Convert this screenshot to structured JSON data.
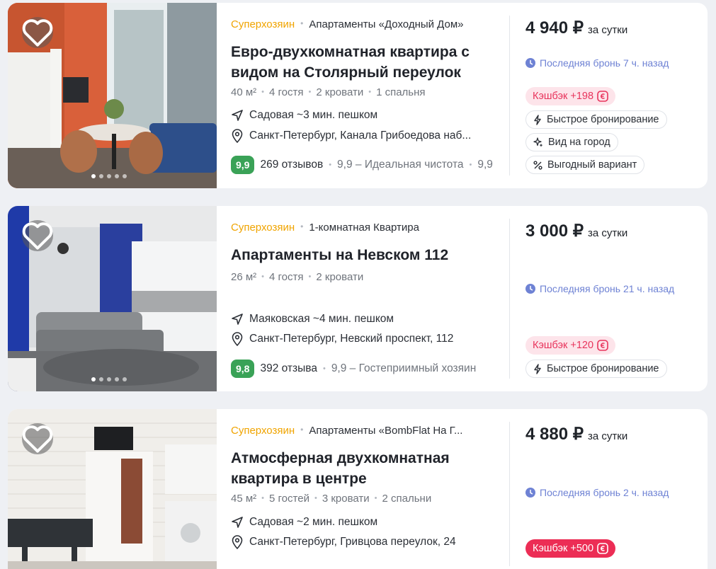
{
  "listings": [
    {
      "superhost": "Суперхозяин",
      "property_type": "Апартаменты «Доходный Дом»",
      "title": "Евро-двухкомнатная квартира с видом на Столярный переулок",
      "specs": [
        "40 м²",
        "4 гостя",
        "2 кровати",
        "1 спальня"
      ],
      "metro": "Садовая ~3 мин. пешком",
      "address": "Санкт-Петербург, Канала Грибоедова наб...",
      "score": "9,9",
      "reviews": "269 отзывов",
      "feature": "9,9 – Идеальная чистота",
      "feature_cut": "9,9",
      "price": "4 940 ₽",
      "per": "за сутки",
      "last_booking": "Последняя бронь 7 ч. назад",
      "cashback": "Кэшбэк +198",
      "tags": [
        "Быстрое бронирование",
        "Вид на город",
        "Выгодный вариант"
      ],
      "tag_icons": [
        "lightning-icon",
        "sparkle-icon",
        "percent-icon"
      ]
    },
    {
      "superhost": "Суперхозяин",
      "property_type": "1-комнатная Квартира",
      "title": "Апартаменты на Невском 112",
      "specs": [
        "26 м²",
        "4 гостя",
        "2 кровати"
      ],
      "metro": "Маяковская ~4 мин. пешком",
      "address": "Санкт-Петербург, Невский проспект, 112",
      "score": "9,8",
      "reviews": "392 отзыва",
      "feature": "9,9 – Гостеприимный хозяин",
      "price": "3 000 ₽",
      "per": "за сутки",
      "last_booking": "Последняя бронь 21 ч. назад",
      "cashback": "Кэшбэк +120",
      "tags": [
        "Быстрое бронирование"
      ],
      "tag_icons": [
        "lightning-icon"
      ]
    },
    {
      "superhost": "Суперхозяин",
      "property_type": "Апартаменты «BombFlat На Г...",
      "title": "Атмосферная двухкомнатная квартира в центре",
      "specs": [
        "45 м²",
        "5 гостей",
        "3 кровати",
        "2 спальни"
      ],
      "metro": "Садовая ~2 мин. пешком",
      "address": "Санкт-Петербург, Гривцова переулок, 24",
      "price": "4 880 ₽",
      "per": "за сутки",
      "last_booking": "Последняя бронь 2 ч. назад",
      "cashback": "Кэшбэк +500"
    }
  ],
  "colors": {
    "superhost": "#f0a400",
    "score_bg": "#3aa257",
    "last_booking": "#6e82d4",
    "cashback_text": "#e8345c",
    "cashback_bg": "#fde4ea",
    "cashback_strong_bg": "#ec2d55"
  }
}
